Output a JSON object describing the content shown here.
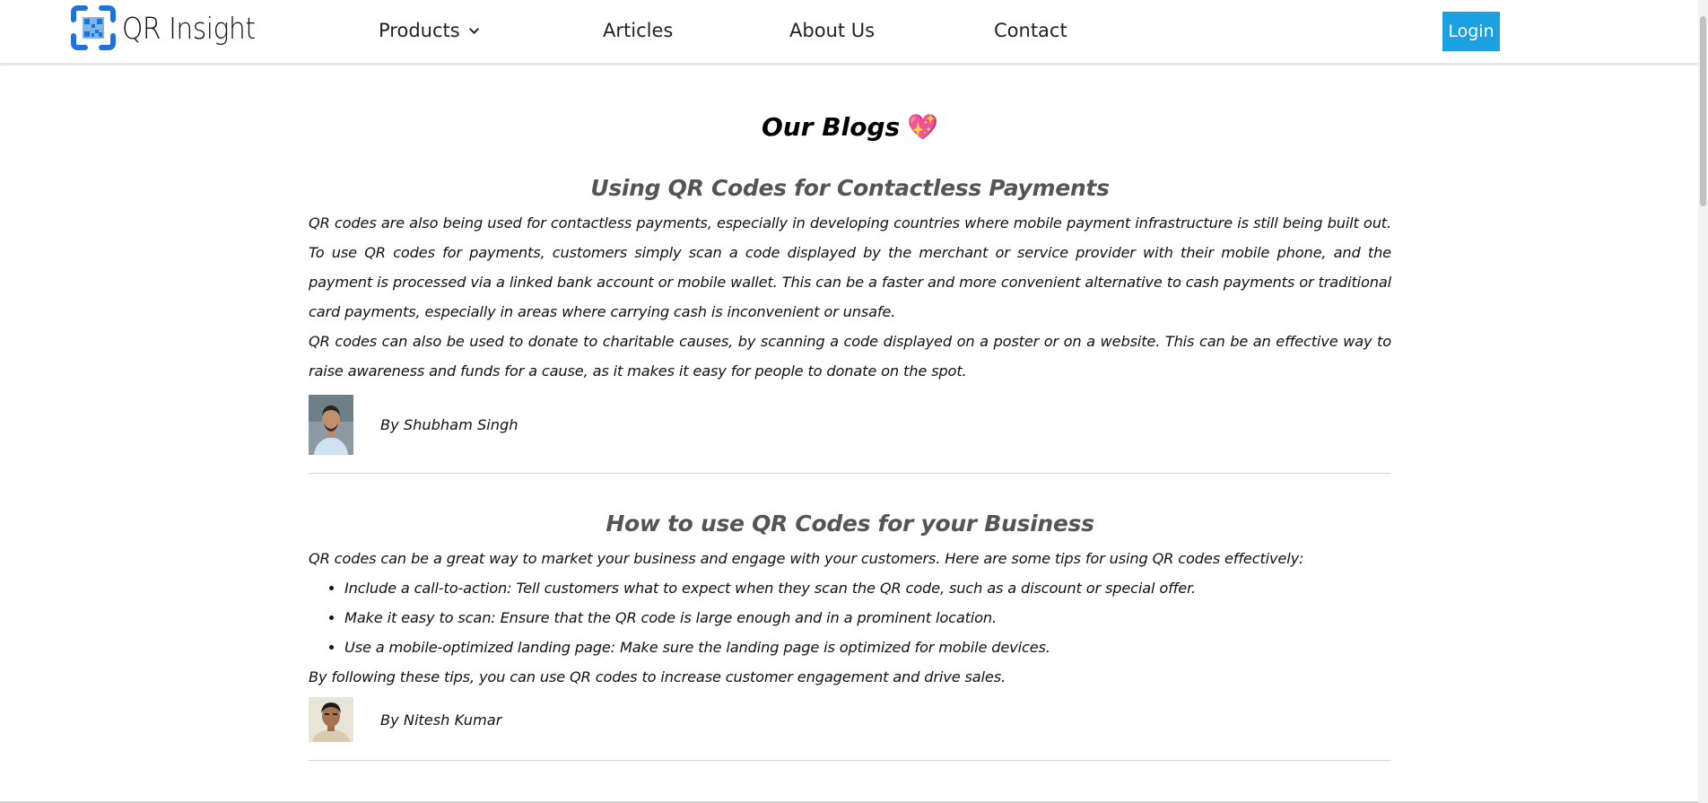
{
  "header": {
    "brand": "QR Insight",
    "nav": {
      "products": "Products",
      "articles": "Articles",
      "about": "About Us",
      "contact": "Contact"
    },
    "login": "Login"
  },
  "page_title": "Our Blogs",
  "posts": [
    {
      "title": "Using QR Codes for Contactless Payments",
      "paragraphs": [
        "QR codes are also being used for contactless payments, especially in developing countries where mobile payment infrastructure is still being built out. To use QR codes for payments, customers simply scan a code displayed by the merchant or service provider with their mobile phone, and the payment is processed via a linked bank account or mobile wallet. This can be a faster and more convenient alternative to cash payments or traditional card payments, especially in areas where carrying cash is inconvenient or unsafe.",
        "QR codes can also be used to donate to charitable causes, by scanning a code displayed on a poster or on a website. This can be an effective way to raise awareness and funds for a cause, as it makes it easy for people to donate on the spot."
      ],
      "author": "By Shubham Singh"
    },
    {
      "title": "How to use QR Codes for your Business",
      "intro": "QR codes can be a great way to market your business and engage with your customers. Here are some tips for using QR codes effectively:",
      "tips": [
        "Include a call-to-action: Tell customers what to expect when they scan the QR code, such as a discount or special offer.",
        "Make it easy to scan: Ensure that the QR code is large enough and in a prominent location.",
        "Use a mobile-optimized landing page: Make sure the landing page is optimized for mobile devices."
      ],
      "outro": "By following these tips, you can use QR codes to increase customer engagement and drive sales.",
      "author": "By Nitesh Kumar"
    }
  ],
  "colors": {
    "accent": "#1ba1e2",
    "logo_blue": "#1e73d8",
    "post_title": "#555555",
    "heart": "#e8336d"
  },
  "icons": {
    "logo": "qr-code-icon",
    "products_dropdown": "chevron-down-icon",
    "title_emoji": "sparkling-heart-icon"
  }
}
